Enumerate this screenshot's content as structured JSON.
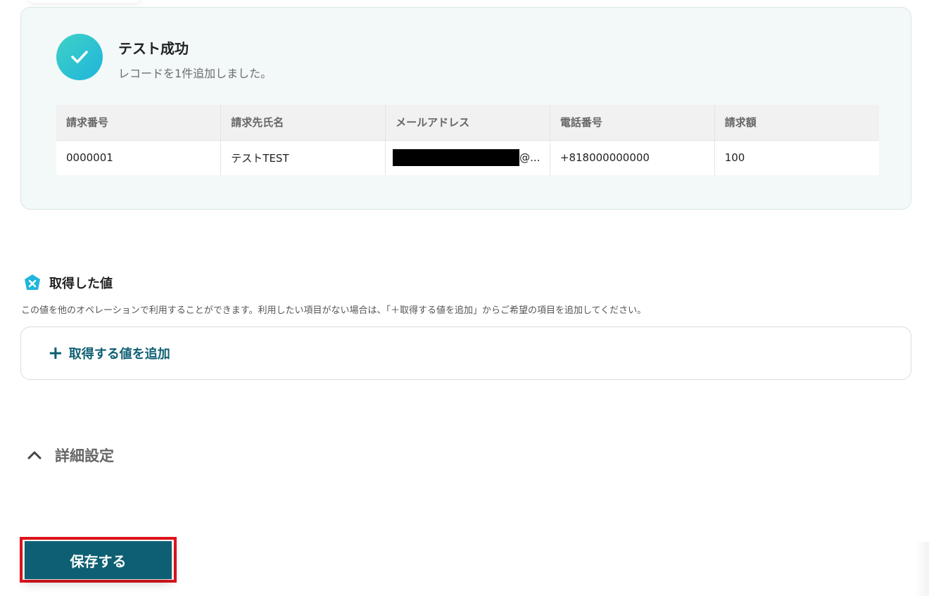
{
  "result": {
    "title": "テスト成功",
    "subtitle": "レコードを1件追加しました。",
    "columns": [
      "請求番号",
      "請求先氏名",
      "メールアドレス",
      "電話番号",
      "請求額"
    ],
    "row": {
      "invoice_no": "0000001",
      "customer_name": "テストTEST",
      "email_suffix": "@...",
      "phone": "+818000000000",
      "amount": "100"
    }
  },
  "values_section": {
    "title": "取得した値",
    "description": "この値を他のオペレーションで利用することができます。利用したい項目がない場合は、「＋取得する値を追加」からご希望の項目を追加してください。",
    "add_button_label": "取得する値を追加",
    "icon": "yoom-x-icon"
  },
  "details": {
    "label": "詳細設定",
    "icon": "chevron-up-icon"
  },
  "save": {
    "label": "保存する"
  },
  "colors": {
    "accent": "#0e5f73",
    "highlight_border": "#e0141b",
    "success_gradient_start": "#3fd1c6",
    "success_gradient_end": "#1fb5dc"
  }
}
